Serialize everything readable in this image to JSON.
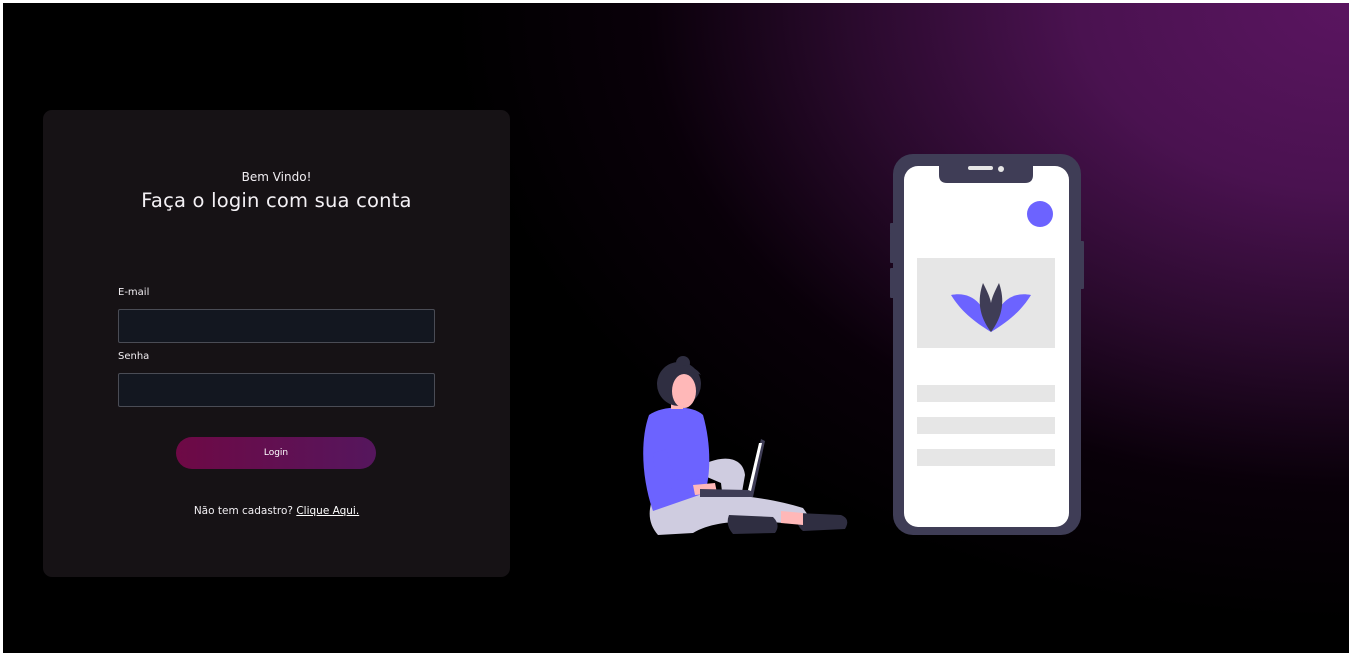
{
  "login_card": {
    "welcome": "Bem Vindo!",
    "headline": "Faça o login com sua conta",
    "email_label": "E-mail",
    "email_value": "",
    "password_label": "Senha",
    "password_value": "",
    "login_button": "Login",
    "signup_prompt": "Não tem cadastro?",
    "signup_link": "Clique Aqui."
  },
  "colors": {
    "background_accent": "#5a1560",
    "card_background": "#161215",
    "input_background": "#131720",
    "button_gradient_start": "#6e0945",
    "button_gradient_end": "#55165d",
    "illustration_accent": "#6c63ff"
  },
  "icons": {
    "illustration": "person-with-laptop-and-phone-illustration",
    "app_logo": "lotus-icon"
  }
}
